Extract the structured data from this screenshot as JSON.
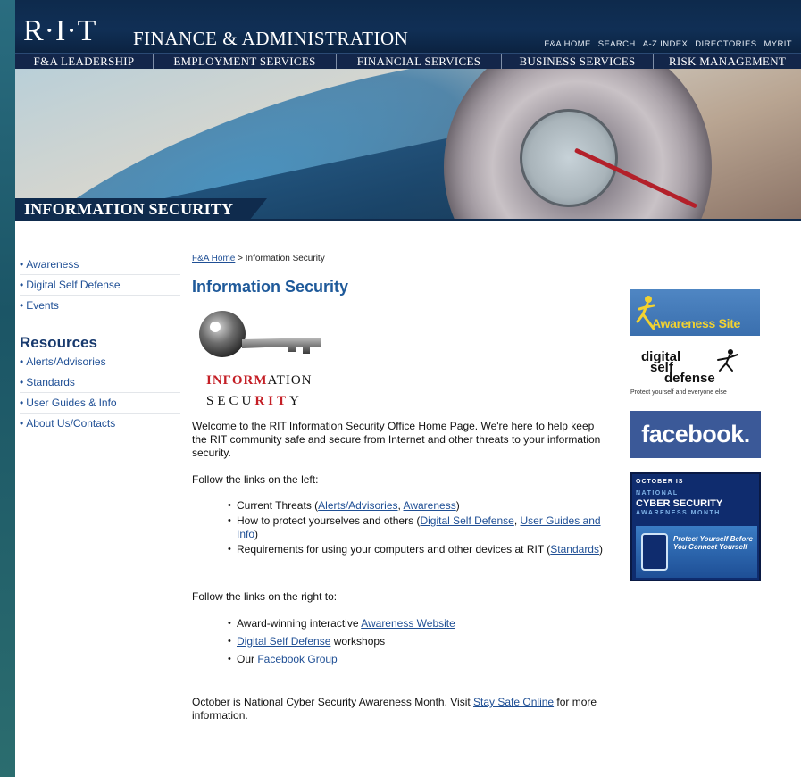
{
  "header": {
    "logo": "R·I·T",
    "site_title": "FINANCE & ADMINISTRATION",
    "utility_nav": [
      "F&A HOME",
      "SEARCH",
      "A-Z INDEX",
      "DIRECTORIES",
      "MYRIT"
    ],
    "main_nav": [
      "F&A LEADERSHIP",
      "EMPLOYMENT SERVICES",
      "FINANCIAL SERVICES",
      "BUSINESS SERVICES",
      "RISK MANAGEMENT"
    ]
  },
  "banner": {
    "title": "INFORMATION SECURITY"
  },
  "sidebar": {
    "links": [
      "Awareness",
      "Digital Self Defense",
      "Events"
    ],
    "resources_heading": "Resources",
    "resources": [
      "Alerts/Advisories",
      "Standards",
      "User Guides & Info",
      "About Us/Contacts"
    ]
  },
  "breadcrumb": {
    "home": "F&A Home",
    "separator": " > ",
    "current": "Information Security"
  },
  "page_title": "Information Security",
  "logo_text": {
    "line1_red": "INFORM",
    "line1_rest": "ATION",
    "line2_a": "SECU",
    "line2_red": "RIT",
    "line2_b": "Y"
  },
  "intro": "Welcome to the RIT Information Security Office Home Page. We're here to help keep the RIT community safe and secure from Internet and other threats to your information security.",
  "follow_left": "Follow the links on the left:",
  "left_items": {
    "i1_pre": "Current Threats (",
    "i1_l1": "Alerts/Advisories",
    "i1_mid": ", ",
    "i1_l2": "Awareness",
    "i1_post": ")",
    "i2_pre": "How to protect yourselves and others (",
    "i2_l1": "Digital Self Defense",
    "i2_mid": ", ",
    "i2_l2": "User Guides and Info",
    "i2_post": ")",
    "i3_pre": "Requirements for using your computers and other devices at RIT (",
    "i3_l1": "Standards",
    "i3_post": ")"
  },
  "follow_right": "Follow the links on the right to:",
  "right_items": {
    "r1_pre": "Award-winning interactive ",
    "r1_link": "Awareness Website",
    "r2_link": "Digital Self Defense",
    "r2_post": " workshops",
    "r3_pre": "Our ",
    "r3_link": "Facebook Group"
  },
  "october": {
    "pre": "October is National Cyber Security Awareness Month. Visit ",
    "link": "Stay Safe Online",
    "post": " for more information."
  },
  "badges": {
    "awareness": "Awareness Site",
    "dsd_1": "digital",
    "dsd_2": "self",
    "dsd_3": "defense",
    "dsd_tag": "Protect yourself and everyone else",
    "facebook": "facebook.",
    "ncsam_top": "OCTOBER IS",
    "ncsam_1": "NATIONAL",
    "ncsam_2": "CYBER SECURITY",
    "ncsam_3": "AWARENESS MONTH",
    "ncsam_msg": "Protect Yourself Before You Connect Yourself"
  },
  "colors": {
    "header_navy": "#0e2a4c",
    "link_blue": "#1f4f95",
    "title_blue": "#1f5a9a",
    "infosec_red": "#c41f26",
    "facebook_blue": "#3b5998"
  }
}
